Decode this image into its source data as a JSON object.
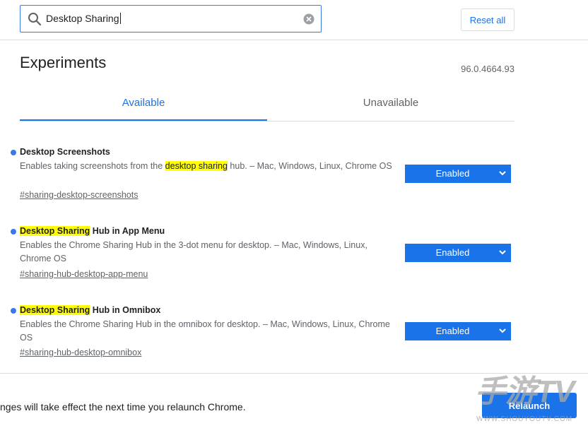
{
  "search": {
    "value": "Desktop Sharing"
  },
  "header": {
    "reset_label": "Reset all",
    "title": "Experiments",
    "version": "96.0.4664.93"
  },
  "tabs": [
    {
      "label": "Available"
    },
    {
      "label": "Unavailable"
    }
  ],
  "experiments": [
    {
      "name_highlight": "",
      "name_rest": "Desktop Screenshots",
      "desc_before": "Enables taking screenshots from the ",
      "desc_highlight": "desktop sharing",
      "desc_after": " hub. – Mac, Windows, Linux, Chrome OS",
      "link": "#sharing-desktop-screenshots",
      "value": "Enabled"
    },
    {
      "name_highlight": "Desktop Sharing",
      "name_rest": " Hub in App Menu",
      "desc_before": "Enables the Chrome Sharing Hub in the 3-dot menu for desktop. – Mac, Windows, Linux, Chrome OS",
      "desc_highlight": "",
      "desc_after": "",
      "link": "#sharing-hub-desktop-app-menu",
      "value": "Enabled"
    },
    {
      "name_highlight": "Desktop Sharing",
      "name_rest": " Hub in Omnibox",
      "desc_before": "Enables the Chrome Sharing Hub in the omnibox for desktop. – Mac, Windows, Linux, Chrome OS",
      "desc_highlight": "",
      "desc_after": "",
      "link": "#sharing-hub-desktop-omnibox",
      "value": "Enabled"
    }
  ],
  "footer": {
    "message": "nges will take effect the next time you relaunch Chrome.",
    "relaunch_label": "Relaunch"
  },
  "watermark": {
    "main": "手游TV",
    "sub": "WWW.SHOUYOUTV.COM"
  },
  "colors": {
    "accent": "#1a73e8",
    "highlight": "#ffff00",
    "bullet": "#3b78e7"
  }
}
